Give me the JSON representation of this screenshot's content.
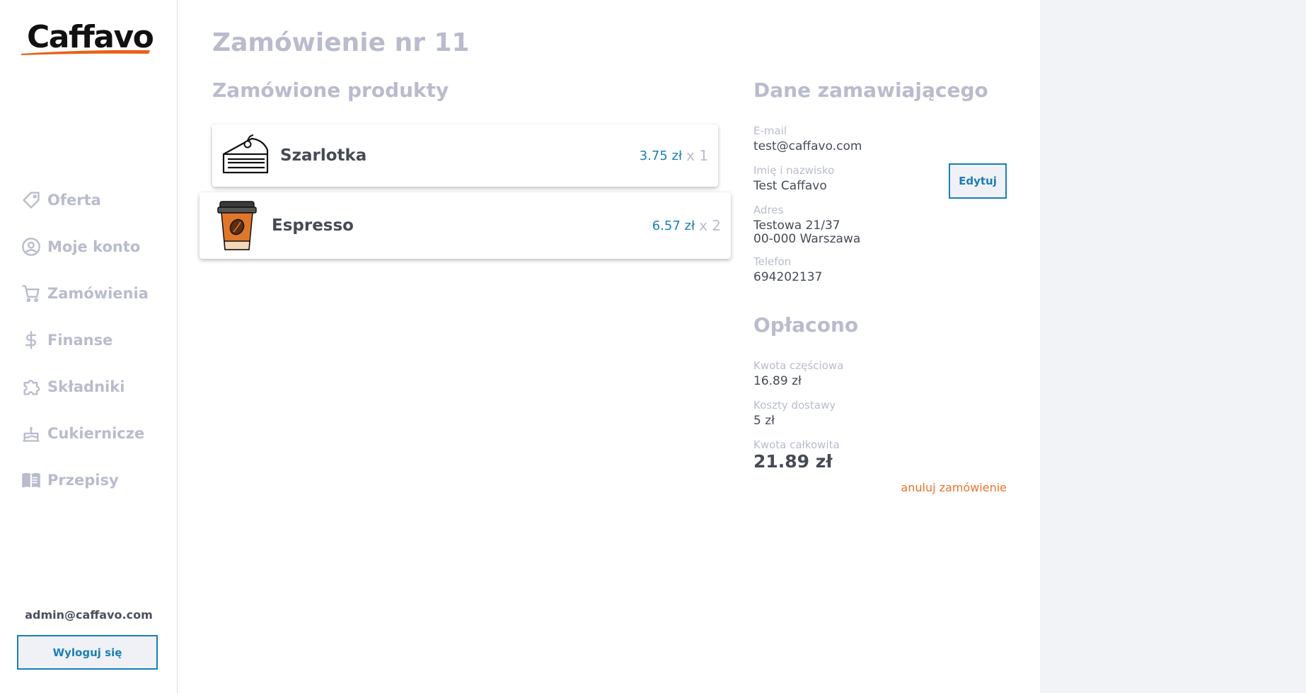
{
  "brand": {
    "logo_text": "Caffavo",
    "accent": "#e8611a",
    "link_color": "#1a7fb5"
  },
  "sidebar": {
    "items": [
      {
        "label": "Oferta",
        "icon": "tag-icon"
      },
      {
        "label": "Moje konto",
        "icon": "user-circle-icon"
      },
      {
        "label": "Zamówienia",
        "icon": "cart-icon"
      },
      {
        "label": "Finanse",
        "icon": "dollar-icon"
      },
      {
        "label": "Składniki",
        "icon": "puzzle-icon"
      },
      {
        "label": "Cukiernicze",
        "icon": "cake-icon"
      },
      {
        "label": "Przepisy",
        "icon": "book-icon"
      }
    ],
    "user_email": "admin@caffavo.com",
    "logout_label": "Wyloguj się"
  },
  "order": {
    "title": "Zamówienie nr 11",
    "products_title": "Zamówione produkty",
    "products": [
      {
        "name": "Szarlotka",
        "price": "3.75 zł",
        "qty": "x 1",
        "icon": "cake-slice-icon"
      },
      {
        "name": "Espresso",
        "price": "6.57 zł",
        "qty": "x 2",
        "icon": "coffee-cup-icon"
      }
    ]
  },
  "customer": {
    "title": "Dane zamawiającego",
    "email_label": "E-mail",
    "email": "test@caffavo.com",
    "name_label": "Imię i nazwisko",
    "name": "Test Caffavo",
    "address_label": "Adres",
    "address_line1": "Testowa 21/37",
    "address_line2": "00-000 Warszawa",
    "phone_label": "Telefon",
    "phone": "694202137",
    "edit_label": "Edytuj"
  },
  "payment": {
    "title": "Opłacono",
    "subtotal_label": "Kwota częściowa",
    "subtotal": "16.89 zł",
    "delivery_label": "Koszty dostawy",
    "delivery": "5 zł",
    "total_label": "Kwota całkowita",
    "total": "21.89 zł",
    "cancel_label": "anuluj zamówienie"
  }
}
